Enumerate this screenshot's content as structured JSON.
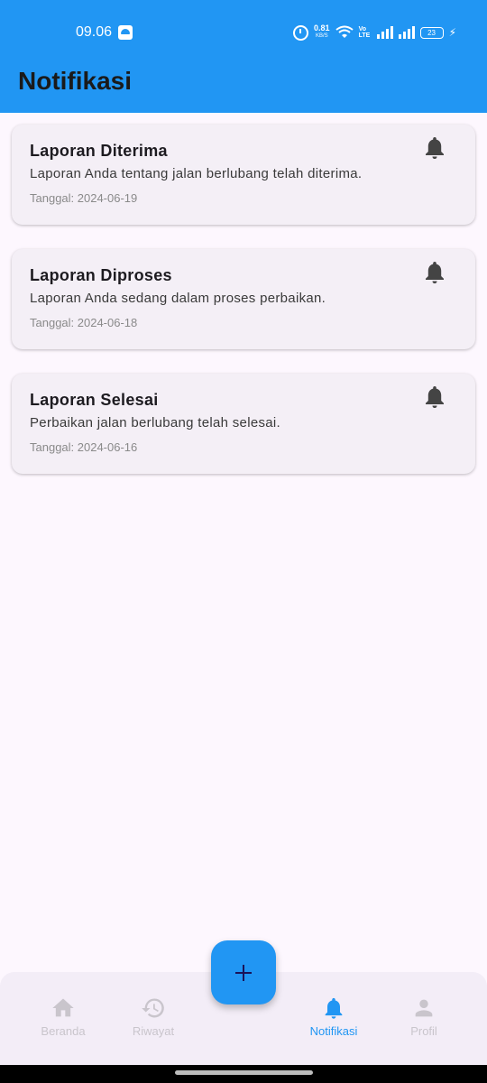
{
  "status_bar": {
    "time": "09.06",
    "net_speed": "0.81",
    "net_unit": "KB/S",
    "volte": "Vo LTE",
    "battery": "23"
  },
  "app_bar": {
    "title": "Notifikasi"
  },
  "notifications": [
    {
      "title": "Laporan Diterima",
      "message": "Laporan Anda tentang jalan berlubang telah diterima.",
      "date": "Tanggal: 2024-06-19"
    },
    {
      "title": "Laporan Diproses",
      "message": "Laporan Anda sedang dalam proses perbaikan.",
      "date": "Tanggal: 2024-06-18"
    },
    {
      "title": "Laporan Selesai",
      "message": "Perbaikan jalan berlubang telah selesai.",
      "date": "Tanggal: 2024-06-16"
    }
  ],
  "bottom_nav": {
    "items": [
      {
        "label": "Beranda",
        "icon": "home-icon",
        "active": false
      },
      {
        "label": "Riwayat",
        "icon": "history-icon",
        "active": false
      },
      {
        "label": "Notifikasi",
        "icon": "bell-icon",
        "active": true
      },
      {
        "label": "Profil",
        "icon": "person-icon",
        "active": false
      }
    ]
  },
  "fab": {
    "icon": "plus-icon"
  },
  "colors": {
    "primary": "#2196f3",
    "background": "#fdf7fe",
    "card": "#f4eff6",
    "nav_background": "#f3edf7",
    "inactive": "#c9c5cc",
    "fab_icon": "#1a1358"
  }
}
